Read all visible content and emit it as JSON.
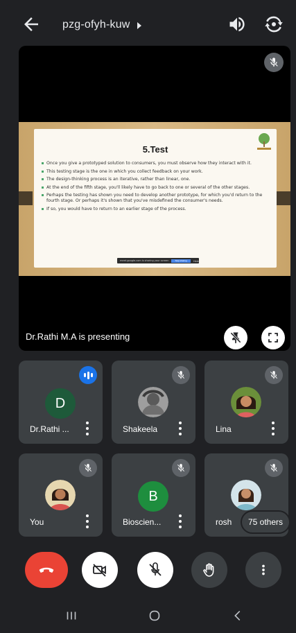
{
  "header": {
    "meeting_code": "pzg-ofyh-kuw",
    "icons": [
      "back-arrow-icon",
      "caret-right-icon",
      "speaker-icon",
      "switch-camera-icon"
    ]
  },
  "presentation": {
    "presenting_label": "Dr.Rathi M.A is presenting",
    "slide": {
      "title": "5.Test",
      "bullets": [
        "Once you give a prototyped solution to consumers, you must observe how they interact with it.",
        "This testing stage is the one in which you collect feedback on your work.",
        "The design-thinking process is an iterative, rather than linear, one.",
        "At the end of the fifth stage, you'll likely have to go back to one or several of the other stages.",
        "Perhaps the testing has shown you need to develop another prototype, for which you'd return to the fourth stage. Or perhaps it's shown that you've misdefined the consumer's needs.",
        "If so, you would have to return to an earlier stage of the process."
      ],
      "share_bar_text": "meet.google.com is sharing your screen",
      "share_bar_button": "Stop sharing",
      "share_bar_hide": "Hide"
    }
  },
  "participants": [
    {
      "name": "Dr.Rathi ...",
      "avatar_letter": "D",
      "status": "speaking"
    },
    {
      "name": "Shakeela",
      "avatar": "photo",
      "status": "muted"
    },
    {
      "name": "Lina",
      "avatar": "photo",
      "status": "muted"
    },
    {
      "name": "You",
      "avatar": "photo",
      "status": "muted"
    },
    {
      "name": "Bioscien...",
      "avatar_letter": "B",
      "status": "muted"
    },
    {
      "name": "rosh",
      "avatar": "photo",
      "status": "muted"
    }
  ],
  "others_count": "75 others",
  "colors": {
    "background": "#202124",
    "tile": "#3c4043",
    "leave_red": "#ea4335",
    "speaking_blue": "#1a73e8",
    "avatar_d": "#1e5a3a",
    "avatar_b": "#1e8e3e"
  }
}
